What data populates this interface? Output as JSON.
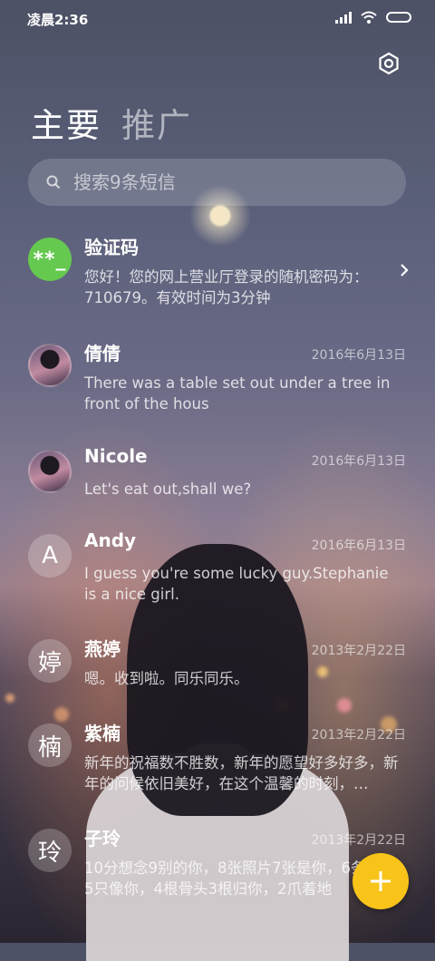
{
  "status_bar": {
    "time": "凌晨2:36"
  },
  "tabs": [
    {
      "label": "主要"
    },
    {
      "label": "推广"
    }
  ],
  "search": {
    "placeholder": "搜索9条短信"
  },
  "messages": [
    {
      "name": "验证码",
      "avatar_text": "**_",
      "date": "",
      "preview": "您好！您的网上营业厅登录的随机密码为：710679。有效时间为3分钟"
    },
    {
      "name": "倩倩",
      "avatar_text": "",
      "date": "2016年6月13日",
      "preview": "There was a table set out under a tree in front of the hous"
    },
    {
      "name": "Nicole",
      "avatar_text": "",
      "date": "2016年6月13日",
      "preview": "Let's eat out,shall we?"
    },
    {
      "name": "Andy",
      "avatar_text": "A",
      "date": "2016年6月13日",
      "preview": "I guess you're some lucky guy.Stephanie is a nice girl."
    },
    {
      "name": "燕婷",
      "avatar_text": "婷",
      "date": "2013年2月22日",
      "preview": "嗯。收到啦。同乐同乐。"
    },
    {
      "name": "紫楠",
      "avatar_text": "楠",
      "date": "2013年2月22日",
      "preview": "新年的祝福数不胜数，新年的愿望好多好多，新年的问候依旧美好，在这个温馨的时刻，…"
    },
    {
      "name": "子玲",
      "avatar_text": "玲",
      "date": "2013年2月22日",
      "preview": "10分想念9别的你，8张照片7张是你，6条小狗5只像你，4根骨头3根归你，2爪着地"
    }
  ],
  "colors": {
    "fab": "#f8c41a",
    "verify_avatar": "#65c94f"
  },
  "icons": {
    "settings": "settings-icon",
    "search": "search-icon",
    "chevron": "chevron-right-icon",
    "compose": "plus-icon"
  }
}
